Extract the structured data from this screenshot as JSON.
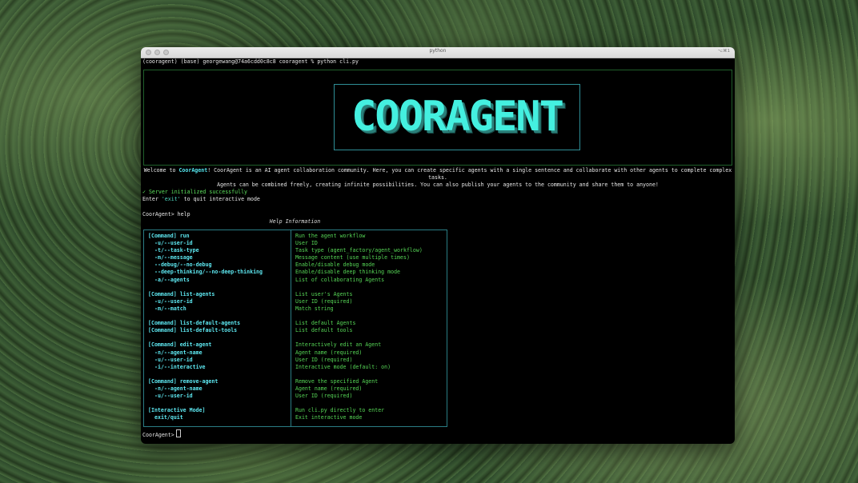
{
  "window": {
    "title": "python",
    "shortcut": "⌥⌘1"
  },
  "terminal": {
    "prompt_line": "(cooragent) (base) georgewang@74a6cdd0c8c8 cooragent % python cli.py",
    "logo_text": "COORAGENT",
    "welcome": {
      "prefix": "Welcome to ",
      "name": "CoorAgent",
      "line1_rest": "! CoorAgent is an AI agent collaboration community. Here, you can create specific agents with a single sentence and collaborate with other agents to complete complex tasks.",
      "line2": "Agents can be combined freely, creating infinite possibilities. You can also publish your agents to the community and share them to anyone!"
    },
    "status": "✓ Server initialized successfully",
    "exit_hint": {
      "prefix": "Enter ",
      "word": "'exit'",
      "suffix": " to quit interactive mode"
    },
    "help_command": "CoorAgent> help",
    "help_title": "Help Information",
    "final_prompt": "CoorAgent>"
  },
  "help_rows": [
    {
      "cmd": "[Command] run",
      "desc": "Run the agent workflow",
      "opt": false
    },
    {
      "cmd": "-u/--user-id",
      "desc": "User ID",
      "opt": true
    },
    {
      "cmd": "-t/--task-type",
      "desc": "Task type (agent_factory/agent_workflow)",
      "opt": true
    },
    {
      "cmd": "-m/--message",
      "desc": "Message content (use multiple times)",
      "opt": true
    },
    {
      "cmd": "--debug/--no-debug",
      "desc": "Enable/disable debug mode",
      "opt": true
    },
    {
      "cmd": "--deep-thinking/--no-deep-thinking",
      "desc": "Enable/disable deep thinking mode",
      "opt": true
    },
    {
      "cmd": "-a/--agents",
      "desc": "List of collaborating Agents",
      "opt": true
    },
    {
      "cmd": "",
      "desc": "",
      "opt": false
    },
    {
      "cmd": "[Command] list-agents",
      "desc": "List user's Agents",
      "opt": false
    },
    {
      "cmd": "-u/--user-id",
      "desc": "User ID (required)",
      "opt": true
    },
    {
      "cmd": "-m/--match",
      "desc": "Match string",
      "opt": true
    },
    {
      "cmd": "",
      "desc": "",
      "opt": false
    },
    {
      "cmd": "[Command] list-default-agents",
      "desc": "List default Agents",
      "opt": false
    },
    {
      "cmd": "[Command] list-default-tools",
      "desc": "List default tools",
      "opt": false
    },
    {
      "cmd": "",
      "desc": "",
      "opt": false
    },
    {
      "cmd": "[Command] edit-agent",
      "desc": "Interactively edit an Agent",
      "opt": false
    },
    {
      "cmd": "-n/--agent-name",
      "desc": "Agent name (required)",
      "opt": true
    },
    {
      "cmd": "-u/--user-id",
      "desc": "User ID (required)",
      "opt": true
    },
    {
      "cmd": "-i/--interactive",
      "desc": "Interactive mode (default: on)",
      "opt": true
    },
    {
      "cmd": "",
      "desc": "",
      "opt": false
    },
    {
      "cmd": "[Command] remove-agent",
      "desc": "Remove the specified Agent",
      "opt": false
    },
    {
      "cmd": "-n/--agent-name",
      "desc": "Agent name (required)",
      "opt": true
    },
    {
      "cmd": "-u/--user-id",
      "desc": "User ID (required)",
      "opt": true
    },
    {
      "cmd": "",
      "desc": "",
      "opt": false
    },
    {
      "cmd": "[Interactive Mode]",
      "desc": "Run cli.py directly to enter",
      "opt": false
    },
    {
      "cmd": "exit/quit",
      "desc": "Exit interactive mode",
      "opt": true
    }
  ]
}
